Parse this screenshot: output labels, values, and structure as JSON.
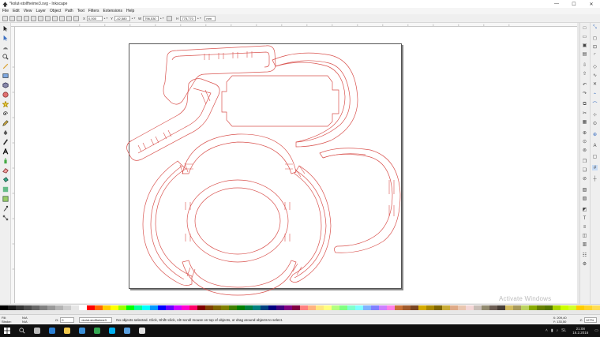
{
  "window": {
    "title": "*kolut-stolfheime3.svg - Inkscape",
    "minimize": "—",
    "maximize": "☐",
    "close": "✕"
  },
  "menu": [
    "File",
    "Edit",
    "View",
    "Layer",
    "Object",
    "Path",
    "Text",
    "Filters",
    "Extensions",
    "Help"
  ],
  "controls": {
    "x_label": "X",
    "x_value": "0,000",
    "y_label": "Y",
    "y_value": "-42,580",
    "w_label": "W",
    "w_value": "796,530",
    "h_label": "H",
    "h_value": "775,770",
    "unit": "mm"
  },
  "status": {
    "fill_label": "Fill:",
    "fill_value": "N/A",
    "stroke_label": "Stroke:",
    "stroke_value": "N/A",
    "opacity_label": "O:",
    "opacity_value": "0",
    "layer": "•kolut-stolfheime3",
    "message": "No objects selected. Click, Shift+click, Alt+scroll mouse on top of objects, or drag around objects to select.",
    "x_readout": "X: 209,40",
    "y_readout": "Y: 133,50",
    "zoom_label": "Z:",
    "zoom_value": "127%"
  },
  "watermark": "Activate Windows",
  "taskbar": {
    "clock_time": "21:08",
    "clock_date": "16.2.2016",
    "language": "SL",
    "apps": [
      {
        "name": "task-view",
        "color": "#bbbbbb"
      },
      {
        "name": "edge",
        "color": "#2a7fd4"
      },
      {
        "name": "file-explorer",
        "color": "#f2c94c"
      },
      {
        "name": "store",
        "color": "#3a8fd8"
      },
      {
        "name": "chrome",
        "color": "#34a853"
      },
      {
        "name": "skype",
        "color": "#00aff0"
      },
      {
        "name": "photos",
        "color": "#5aa0e0"
      },
      {
        "name": "inkscape",
        "color": "#e0e0e0"
      }
    ]
  },
  "colors": {
    "path_stroke": "#d9534f",
    "canvas": "#ffffff",
    "palette": [
      "#000000",
      "#1a1a1a",
      "#333333",
      "#4d4d4d",
      "#666666",
      "#808080",
      "#999999",
      "#b3b3b3",
      "#cccccc",
      "#e6e6e6",
      "#ffffff",
      "#ff0000",
      "#ff6600",
      "#ffcc00",
      "#ffff00",
      "#99ff00",
      "#00ff00",
      "#00ff99",
      "#00ffff",
      "#0099ff",
      "#0000ff",
      "#6600ff",
      "#cc00ff",
      "#ff00cc",
      "#ff0066",
      "#800000",
      "#804000",
      "#806600",
      "#808000",
      "#408000",
      "#008000",
      "#008040",
      "#008080",
      "#004080",
      "#000080",
      "#400080",
      "#800080",
      "#800040",
      "#ff8080",
      "#ffb380",
      "#ffe680",
      "#ffff80",
      "#b3ff80",
      "#80ff80",
      "#80ffcc",
      "#80ffff",
      "#80b3ff",
      "#8080ff",
      "#cc80ff",
      "#ff80e6",
      "#c87137",
      "#a05a2c",
      "#784421",
      "#d4aa00",
      "#aa8800",
      "#806600",
      "#c8ab37",
      "#deaa87",
      "#e9c6af",
      "#f4d7d7",
      "#c8beb7",
      "#918a6f",
      "#6c5d53",
      "#483e37",
      "#d3bc5f",
      "#a89a5a",
      "#bcd35f",
      "#88aa00",
      "#668000",
      "#557700",
      "#aad400",
      "#ccff00",
      "#d4ff2a",
      "#ffcc00",
      "#ffd42a",
      "#ffdd55"
    ]
  }
}
